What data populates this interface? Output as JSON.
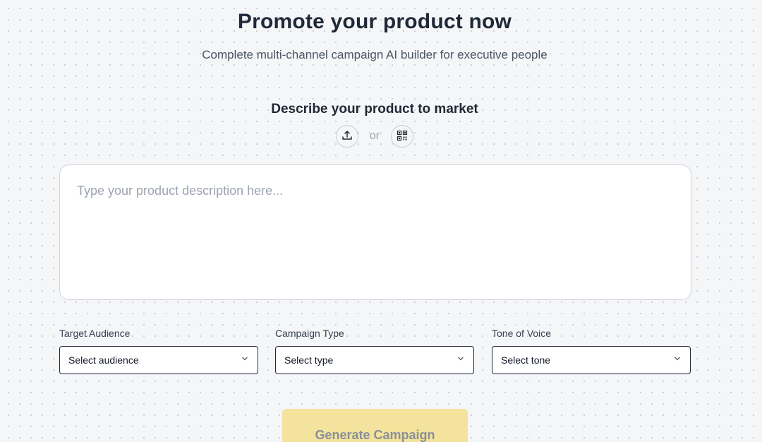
{
  "header": {
    "title": "Promote your product now",
    "subtitle": "Complete multi-channel campaign AI builder for executive people"
  },
  "describe": {
    "heading": "Describe your product to market",
    "upload_icon": "upload-icon",
    "or_text": "or",
    "qr_icon": "qr-code-icon",
    "placeholder": "Type your product description here..."
  },
  "fields": {
    "audience": {
      "label": "Target Audience",
      "value": "Select audience"
    },
    "campaign_type": {
      "label": "Campaign Type",
      "value": "Select type"
    },
    "tone": {
      "label": "Tone of Voice",
      "value": "Select tone"
    }
  },
  "actions": {
    "generate_label": "Generate Campaign",
    "generate_color": "#f3e39c"
  }
}
